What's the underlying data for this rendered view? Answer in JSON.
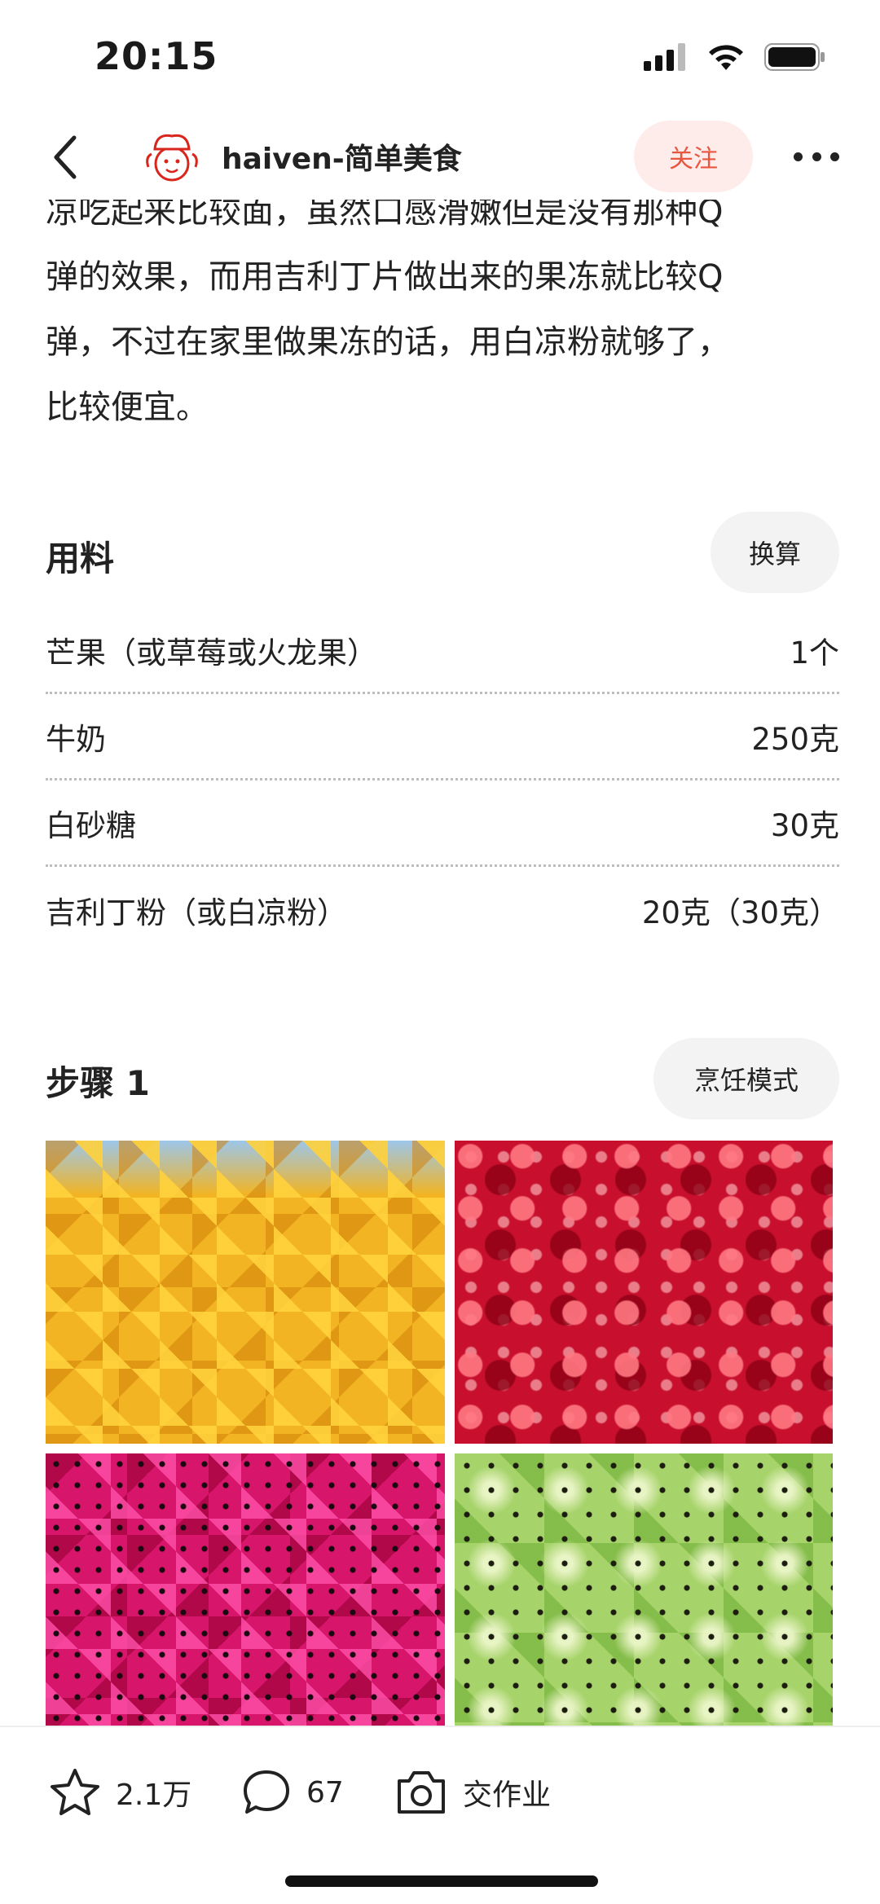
{
  "status_bar": {
    "time": "20:15"
  },
  "header": {
    "author_name": "haiven-简单美食",
    "follow_label": "关注"
  },
  "intro": {
    "lines": [
      "凉吃起来比较面，虽然口感滑嫩但是没有那种Q",
      "弹的效果，而用吉利丁片做出来的果冻就比较Q",
      "弹，不过在家里做果冻的话，用白凉粉就够了，",
      "比较便宜。"
    ]
  },
  "ingredients_section": {
    "title": "用料",
    "convert_label": "换算",
    "items": [
      {
        "name": "芒果（或草莓或火龙果）",
        "amount": "1个"
      },
      {
        "name": "牛奶",
        "amount": "250克"
      },
      {
        "name": "白砂糖",
        "amount": "30克"
      },
      {
        "name": "吉利丁粉（或白凉粉）",
        "amount": "20克（30克）"
      }
    ]
  },
  "step_section": {
    "title": "步骤 1",
    "cook_mode_label": "烹饪模式",
    "photos": [
      "mango-cubes",
      "strawberry-pieces",
      "dragonfruit-cubes",
      "kiwi-slices"
    ]
  },
  "bottom_bar": {
    "favorites": "2.1万",
    "comments": "67",
    "homework_label": "交作业"
  },
  "colors": {
    "follow_bg": "#fdecea",
    "follow_text": "#e8563f",
    "pill_bg": "#f3f3f3"
  }
}
